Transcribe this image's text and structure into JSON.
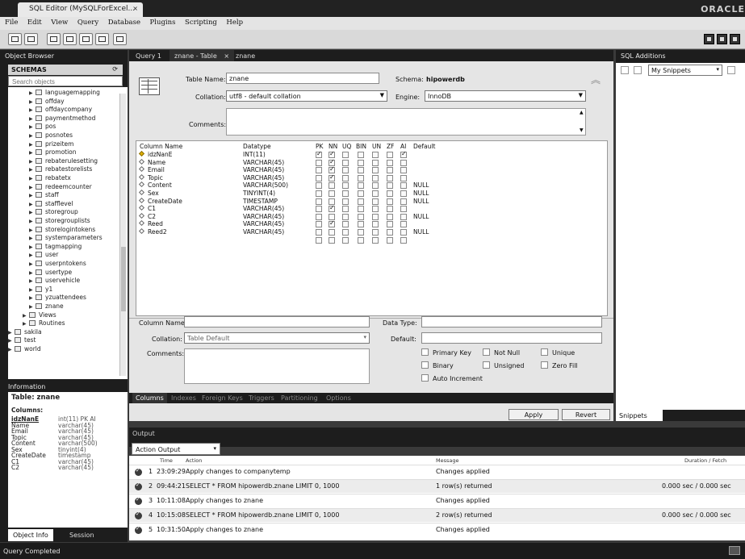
{
  "window": {
    "tab_title": "SQL Editor (MySQLForExcel...",
    "close": "×",
    "brand": "ORACLE"
  },
  "menu": [
    "File",
    "Edit",
    "View",
    "Query",
    "Database",
    "Plugins",
    "Scripting",
    "Help"
  ],
  "left": {
    "header": "Object Browser",
    "schemas_label": "SCHEMAS",
    "search_placeholder": "Search objects",
    "tree": [
      {
        "label": "languagemapping",
        "kind": "table"
      },
      {
        "label": "offday",
        "kind": "table"
      },
      {
        "label": "offdaycompany",
        "kind": "table"
      },
      {
        "label": "paymentmethod",
        "kind": "table"
      },
      {
        "label": "pos",
        "kind": "table"
      },
      {
        "label": "posnotes",
        "kind": "table"
      },
      {
        "label": "prizeitem",
        "kind": "table"
      },
      {
        "label": "promotion",
        "kind": "table"
      },
      {
        "label": "rebaterulesetting",
        "kind": "table"
      },
      {
        "label": "rebatestorelists",
        "kind": "table"
      },
      {
        "label": "rebatetx",
        "kind": "table"
      },
      {
        "label": "redeemcounter",
        "kind": "table"
      },
      {
        "label": "staff",
        "kind": "table"
      },
      {
        "label": "stafflevel",
        "kind": "table"
      },
      {
        "label": "storegroup",
        "kind": "table"
      },
      {
        "label": "storegrouplists",
        "kind": "table"
      },
      {
        "label": "storelogintokens",
        "kind": "table"
      },
      {
        "label": "systemparameters",
        "kind": "table"
      },
      {
        "label": "tagmapping",
        "kind": "table"
      },
      {
        "label": "user",
        "kind": "table"
      },
      {
        "label": "userpntokens",
        "kind": "table"
      },
      {
        "label": "usertype",
        "kind": "table"
      },
      {
        "label": "uservehicle",
        "kind": "table"
      },
      {
        "label": "y1",
        "kind": "table"
      },
      {
        "label": "yzuattendees",
        "kind": "table"
      },
      {
        "label": "znane",
        "kind": "table"
      },
      {
        "label": "Views",
        "kind": "folder"
      },
      {
        "label": "Routines",
        "kind": "folder"
      },
      {
        "label": "sakila",
        "kind": "schema"
      },
      {
        "label": "test",
        "kind": "schema"
      },
      {
        "label": "world",
        "kind": "schema"
      }
    ],
    "info_header": "Information",
    "info_table": "Table: znane",
    "info_columns_label": "Columns:",
    "info_columns": [
      {
        "name": "idzNanE",
        "type": "int(11) PK AI"
      },
      {
        "name": "Name",
        "type": "varchar(45)"
      },
      {
        "name": "Email",
        "type": "varchar(45)"
      },
      {
        "name": "Topic",
        "type": "varchar(45)"
      },
      {
        "name": "Content",
        "type": "varchar(500)"
      },
      {
        "name": "Sex",
        "type": "tinyint(4)"
      },
      {
        "name": "CreateDate",
        "type": "timestamp"
      },
      {
        "name": "C1",
        "type": "varchar(45)"
      },
      {
        "name": "C2",
        "type": "varchar(45)"
      }
    ],
    "tabs": [
      "Object Info",
      "Session"
    ]
  },
  "center": {
    "tabs": [
      "Query 1",
      "znane - Table",
      "znane"
    ],
    "table_name_label": "Table Name:",
    "table_name": "znane",
    "schema_label": "Schema:",
    "schema": "hipowerdb",
    "collation_label": "Collation:",
    "collation": "utf8 - default collation",
    "engine_label": "Engine:",
    "engine": "InnoDB",
    "comments_label": "Comments:",
    "grid_headers": [
      "Column Name",
      "Datatype",
      "PK",
      "NN",
      "UQ",
      "BIN",
      "UN",
      "ZF",
      "AI",
      "Default"
    ],
    "columns": [
      {
        "name": "idzNanE",
        "type": "INT(11)",
        "flags": [
          1,
          1,
          0,
          0,
          0,
          0,
          1
        ],
        "default": "",
        "key": true
      },
      {
        "name": "Name",
        "type": "VARCHAR(45)",
        "flags": [
          0,
          1,
          0,
          0,
          0,
          0,
          0
        ],
        "default": ""
      },
      {
        "name": "Email",
        "type": "VARCHAR(45)",
        "flags": [
          0,
          1,
          0,
          0,
          0,
          0,
          0
        ],
        "default": ""
      },
      {
        "name": "Topic",
        "type": "VARCHAR(45)",
        "flags": [
          0,
          1,
          0,
          0,
          0,
          0,
          0
        ],
        "default": ""
      },
      {
        "name": "Content",
        "type": "VARCHAR(500)",
        "flags": [
          0,
          0,
          0,
          0,
          0,
          0,
          0
        ],
        "default": "NULL"
      },
      {
        "name": "Sex",
        "type": "TINYINT(4)",
        "flags": [
          0,
          0,
          0,
          0,
          0,
          0,
          0
        ],
        "default": "NULL"
      },
      {
        "name": "CreateDate",
        "type": "TIMESTAMP",
        "flags": [
          0,
          0,
          0,
          0,
          0,
          0,
          0
        ],
        "default": "NULL"
      },
      {
        "name": "C1",
        "type": "VARCHAR(45)",
        "flags": [
          0,
          1,
          0,
          0,
          0,
          0,
          0
        ],
        "default": ""
      },
      {
        "name": "C2",
        "type": "VARCHAR(45)",
        "flags": [
          0,
          0,
          0,
          0,
          0,
          0,
          0
        ],
        "default": "NULL"
      },
      {
        "name": "Reed",
        "type": "VARCHAR(45)",
        "flags": [
          0,
          1,
          0,
          0,
          0,
          0,
          0
        ],
        "default": ""
      },
      {
        "name": "Reed2",
        "type": "VARCHAR(45)",
        "flags": [
          0,
          0,
          0,
          0,
          0,
          0,
          0
        ],
        "default": "NULL"
      }
    ],
    "column_name_label": "Column Name:",
    "data_type_label": "Data Type:",
    "col_collation_label": "Collation:",
    "col_collation": "Table Default",
    "default_label": "Default:",
    "col_comments_label": "Comments:",
    "options": [
      "Primary Key",
      "Not Null",
      "Unique",
      "Binary",
      "Unsigned",
      "Zero Fill",
      "Auto Increment"
    ],
    "bottom_tabs": [
      "Columns",
      "Indexes",
      "Foreign Keys",
      "Triggers",
      "Partitioning",
      "Options"
    ],
    "apply": "Apply",
    "revert": "Revert"
  },
  "right": {
    "header": "SQL Additions",
    "snippets_select": "My Snippets",
    "snippets_tab": "Snippets"
  },
  "output": {
    "header": "Output",
    "select": "Action Output",
    "headers": [
      "Time",
      "Action",
      "Message",
      "Duration / Fetch"
    ],
    "rows": [
      {
        "n": "1",
        "time": "23:09:29",
        "action": "Apply changes to companytemp",
        "message": "Changes applied",
        "duration": ""
      },
      {
        "n": "2",
        "time": "09:44:21",
        "action": "SELECT * FROM hipowerdb.znane LIMIT 0, 1000",
        "message": "1 row(s) returned",
        "duration": "0.000 sec / 0.000 sec"
      },
      {
        "n": "3",
        "time": "10:11:08",
        "action": "Apply changes to znane",
        "message": "Changes applied",
        "duration": ""
      },
      {
        "n": "4",
        "time": "10:15:08",
        "action": "SELECT * FROM hipowerdb.znane LIMIT 0, 1000",
        "message": "2 row(s) returned",
        "duration": "0.000 sec / 0.000 sec"
      },
      {
        "n": "5",
        "time": "10:31:50",
        "action": "Apply changes to znane",
        "message": "Changes applied",
        "duration": ""
      }
    ]
  },
  "status": "Query Completed"
}
